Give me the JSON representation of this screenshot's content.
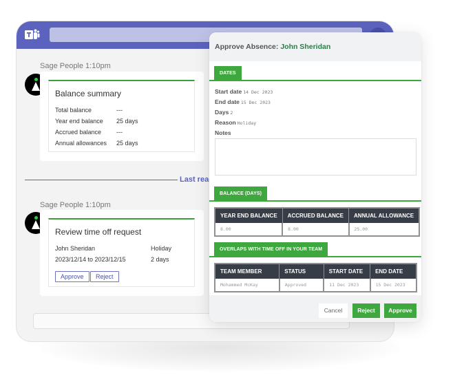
{
  "teams": {
    "logo_icon": "microsoft-teams-icon",
    "last_read_label": "Last read"
  },
  "messages": [
    {
      "sender_time": "Sage People 1:10pm",
      "card": {
        "title": "Balance summary",
        "rows": [
          {
            "label": "Total balance",
            "value": "---"
          },
          {
            "label": "Year end balance",
            "value": "25 days"
          },
          {
            "label": "Accrued balance",
            "value": "---"
          },
          {
            "label": "Annual allowances",
            "value": "25 days"
          }
        ]
      }
    },
    {
      "sender_time": "Sage People 1:10pm",
      "card": {
        "title": "Review time off request",
        "employee": "John Sheridan",
        "type": "Holiday",
        "date_range": "2023/12/14 to 2023/12/15",
        "duration": "2 days",
        "approve_label": "Approve",
        "reject_label": "Reject"
      }
    }
  ],
  "dialog": {
    "title_prefix": "Approve Absence:",
    "title_name": "John Sheridan",
    "dates_tab": "DATES",
    "fields": {
      "start_label": "Start date",
      "start_value": "14 Dec 2023",
      "end_label": "End date",
      "end_value": "15 Dec 2023",
      "days_label": "Days",
      "days_value": "2",
      "reason_label": "Reason",
      "reason_value": "Holiday",
      "notes_label": "Notes",
      "notes_value": ""
    },
    "balance_tab": "BALANCE (DAYS)",
    "balance_table": {
      "headers": [
        "YEAR END BALANCE",
        "ACCRUED BALANCE",
        "ANNUAL ALLOWANCE"
      ],
      "row": [
        "8.00",
        "8.00",
        "25.00"
      ]
    },
    "overlaps_tab": "OVERLAPS WITH TIME OFF IN YOUR TEAM",
    "overlaps_table": {
      "headers": [
        "TEAM MEMBER",
        "STATUS",
        "START DATE",
        "END DATE"
      ],
      "rows": [
        [
          "Mohammed McKay",
          "Approved",
          "11 Dec 2023",
          "15 Dec 2023"
        ]
      ]
    },
    "buttons": {
      "cancel": "Cancel",
      "reject": "Reject",
      "approve": "Approve"
    }
  },
  "colors": {
    "teams_purple": "#5b63bf",
    "accent_green": "#3ea83e",
    "table_header": "#373d47"
  }
}
